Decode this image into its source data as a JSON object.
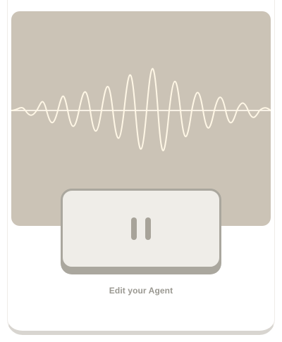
{
  "player": {
    "state": "playing",
    "control_icon": "pause-icon",
    "accent_colors": {
      "panel": "#cbc3b6",
      "waveform": "#fff7e6",
      "button": "#efede8",
      "button_border": "#aaa79e"
    }
  },
  "footer": {
    "edit_label": "Edit your Agent"
  }
}
